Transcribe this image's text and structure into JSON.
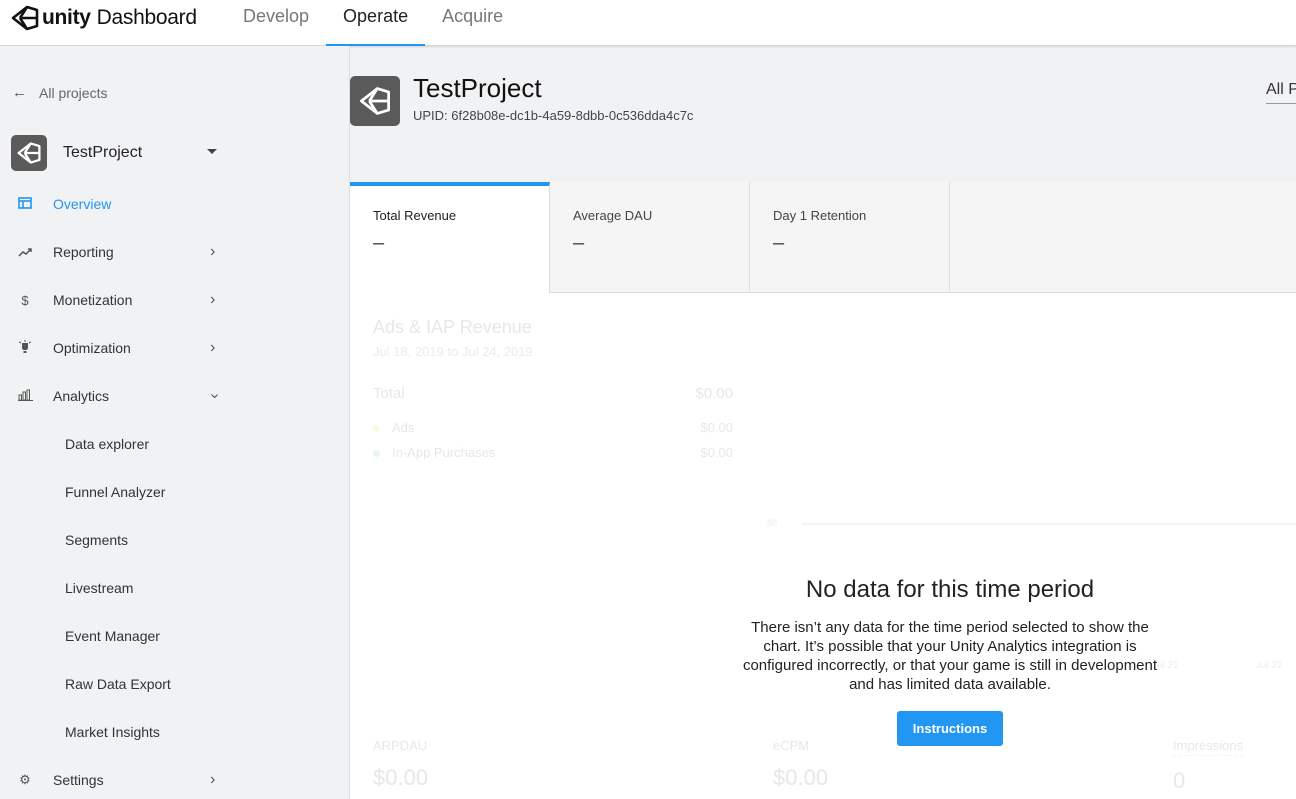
{
  "header": {
    "brand": "unity",
    "product": "Dashboard",
    "tabs": [
      {
        "label": "Develop",
        "active": false
      },
      {
        "label": "Operate",
        "active": true
      },
      {
        "label": "Acquire",
        "active": false
      }
    ]
  },
  "sidebar": {
    "back_label": "All projects",
    "project_name": "TestProject",
    "nav": [
      {
        "label": "Overview",
        "icon": "dashboard-icon",
        "active": true
      },
      {
        "label": "Reporting",
        "icon": "trending-up-icon"
      },
      {
        "label": "Monetization",
        "icon": "dollar-icon"
      },
      {
        "label": "Optimization",
        "icon": "lightbulb-icon"
      },
      {
        "label": "Analytics",
        "icon": "bar-chart-icon",
        "expanded": true
      }
    ],
    "analytics_subitems": [
      "Data explorer",
      "Funnel Analyzer",
      "Segments",
      "Livestream",
      "Event Manager",
      "Raw Data Export",
      "Market Insights"
    ],
    "settings_label": "Settings"
  },
  "main": {
    "title": "TestProject",
    "upid": "UPID: 6f28b08e-dc1b-4a59-8dbb-0c536dda4c7c",
    "filter_label": "All P",
    "kpis": [
      {
        "label": "Total Revenue",
        "value": "–",
        "active": true
      },
      {
        "label": "Average DAU",
        "value": "–"
      },
      {
        "label": "Day 1 Retention",
        "value": "–"
      }
    ],
    "revenue": {
      "title": "Ads & IAP Revenue",
      "dates": "Jul 18, 2019 to Jul 24, 2019",
      "total_label": "Total",
      "total_value": "$0.00",
      "rows": [
        {
          "label": "Ads",
          "value": "$0.00",
          "color": "#d4c84a"
        },
        {
          "label": "In-App Purchases",
          "value": "$0.00",
          "color": "#2bb3a0"
        }
      ],
      "axis_zero": "$0",
      "x_labels": [
        "Jul 21",
        "Jul 22"
      ]
    },
    "metrics": [
      {
        "label": "ARPDAU",
        "value": "$0.00"
      },
      {
        "label": "eCPM",
        "value": "$0.00"
      },
      {
        "label": "Impressions",
        "value": "0"
      }
    ],
    "empty": {
      "title": "No data for this time period",
      "message": "There isn’t any data for the time period selected to show the chart. It’s possible that your Unity Analytics integration is configured incorrectly, or that your game is still in development and has limited data available.",
      "button": "Instructions"
    }
  }
}
